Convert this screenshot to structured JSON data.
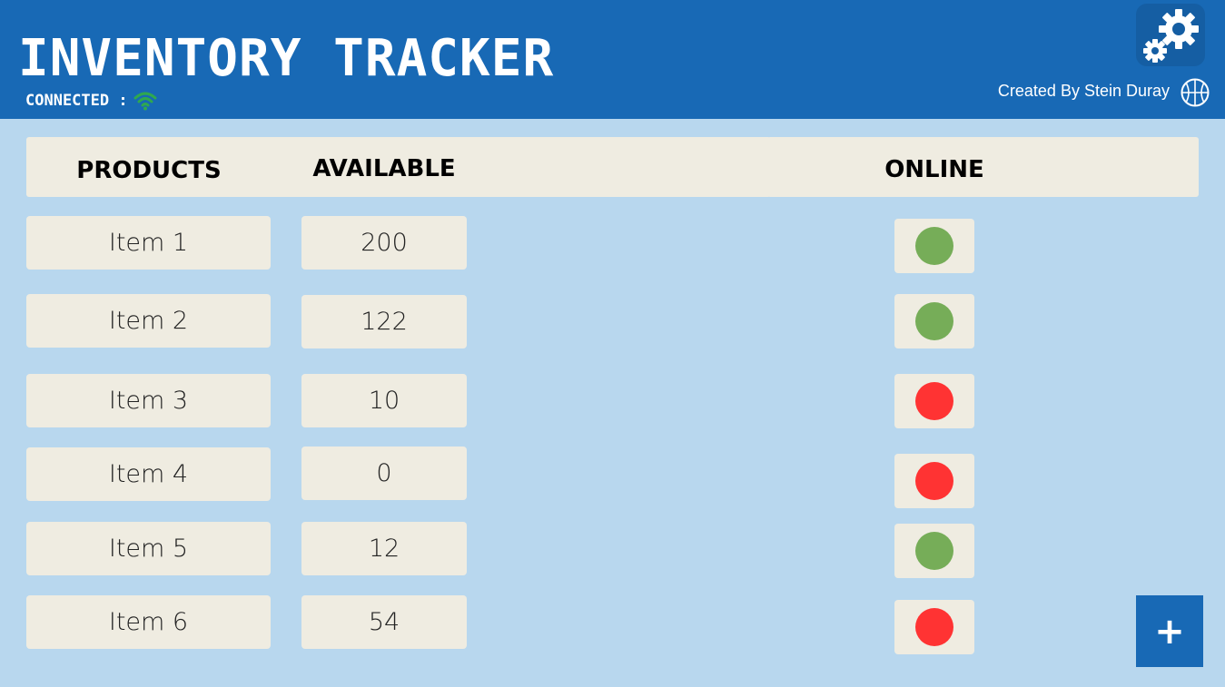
{
  "app": {
    "title": "INVENTORY TRACKER"
  },
  "status": {
    "label": "CONNECTED :",
    "icon": "wifi-icon"
  },
  "header": {
    "credit": "Created By Stein Duray",
    "settings_icon": "gear-icon",
    "logo_icon": "basketball-logo-icon"
  },
  "columns": {
    "products": "PRODUCTS",
    "available": "AVAILABLE",
    "online": "ONLINE"
  },
  "colors": {
    "online": "#76ad58",
    "offline": "#ff3333",
    "header_bg": "#1869b5",
    "page_bg": "#b8d7ee",
    "cell_bg": "#efece1"
  },
  "rows": [
    {
      "product": "Item 1",
      "available": "200",
      "online": true
    },
    {
      "product": "Item 2",
      "available": "122",
      "online": true
    },
    {
      "product": "Item 3",
      "available": "10",
      "online": false
    },
    {
      "product": "Item 4",
      "available": "0",
      "online": false
    },
    {
      "product": "Item 5",
      "available": "12",
      "online": true
    },
    {
      "product": "Item 6",
      "available": "54",
      "online": false
    }
  ],
  "actions": {
    "add_label": "+"
  }
}
